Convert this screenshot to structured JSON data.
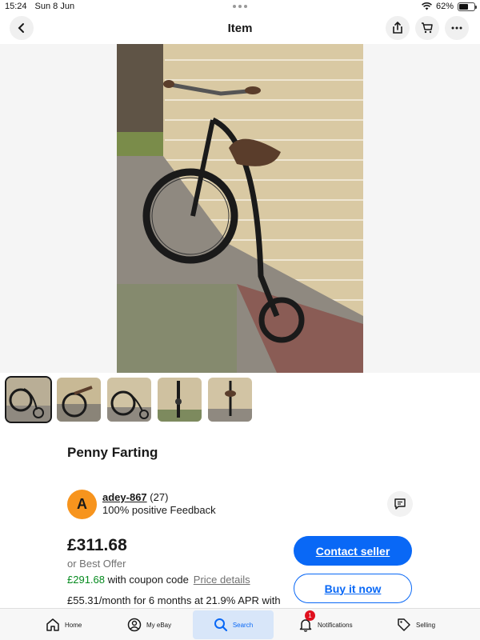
{
  "status": {
    "time": "15:24",
    "date": "Sun 8 Jun",
    "battery": "62%",
    "battery_level": 0.62
  },
  "nav": {
    "title": "Item"
  },
  "listing": {
    "title": "Penny Farting",
    "thumbnail_count": 5
  },
  "seller": {
    "avatar_letter": "A",
    "name": "adey-867",
    "rating_count": "(27)",
    "feedback": "100% positive Feedback"
  },
  "pricing": {
    "price": "£311.68",
    "best_offer": "or Best Offer",
    "coupon_price": "£291.68",
    "coupon_text": " with coupon code",
    "price_details": "Price details",
    "finance": "£55.31/month for 6 months at 21.9% APR with"
  },
  "actions": {
    "contact": "Contact seller",
    "buy": "Buy it now"
  },
  "tabs": [
    {
      "label": "Home"
    },
    {
      "label": "My eBay"
    },
    {
      "label": "Search"
    },
    {
      "label": "Notifications",
      "badge": "1"
    },
    {
      "label": "Selling"
    }
  ],
  "colors": {
    "accent": "#0968f6",
    "coupon": "#058a1e",
    "avatar": "#f7941d",
    "badge": "#e0101e"
  }
}
